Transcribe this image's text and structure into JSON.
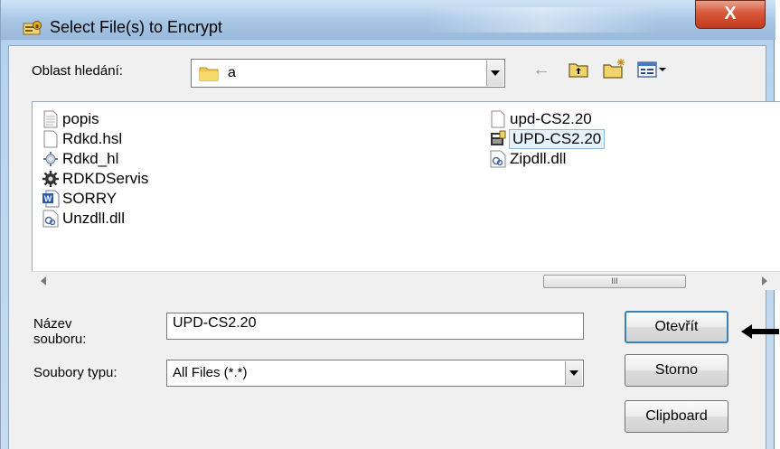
{
  "window": {
    "title": "Select File(s) to Encrypt",
    "close_label": "X"
  },
  "toolbar": {
    "look_in_label": "Oblast hledání:",
    "look_in_value": "a",
    "back_icon": "back-arrow-icon",
    "up_icon": "up-folder-icon",
    "new_folder_icon": "new-folder-icon",
    "view_menu_icon": "view-menu-icon"
  },
  "files": {
    "left_column": [
      {
        "name": "popis",
        "icon": "text-file-icon"
      },
      {
        "name": "Rdkd.hsl",
        "icon": "blank-file-icon"
      },
      {
        "name": "Rdkd_hl",
        "icon": "config-file-icon"
      },
      {
        "name": "RDKDServis",
        "icon": "gear-app-icon"
      },
      {
        "name": "SORRY",
        "icon": "word-doc-icon"
      },
      {
        "name": "Unzdll.dll",
        "icon": "dll-file-icon"
      }
    ],
    "right_column": [
      {
        "name": "upd-CS2.20",
        "icon": "blank-file-icon",
        "selected": false
      },
      {
        "name": "UPD-CS2.20",
        "icon": "executable-icon",
        "selected": true
      },
      {
        "name": "Zipdll.dll",
        "icon": "dll-file-icon",
        "selected": false
      }
    ]
  },
  "scrollbar": {
    "thumb_grip": "III"
  },
  "form": {
    "filename_label": "Název\nsouboru:",
    "filename_value": "UPD-CS2.20",
    "filetype_label": "Soubory typu:",
    "filetype_value": "All Files (*.*)"
  },
  "buttons": {
    "open": "Otevřít",
    "cancel": "Storno",
    "clipboard": "Clipboard"
  }
}
